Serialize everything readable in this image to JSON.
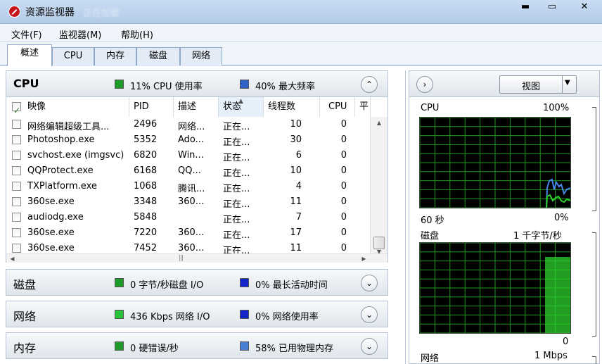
{
  "window": {
    "title": "资源监视器",
    "title_ghost": "正在加载",
    "min_glyph": "▬",
    "max_glyph": "▭",
    "close_glyph": "✕"
  },
  "menu": [
    "文件(F)",
    "监视器(M)",
    "帮助(H)"
  ],
  "tabs": [
    {
      "label": "概述",
      "active": true
    },
    {
      "label": "CPU",
      "active": false
    },
    {
      "label": "内存",
      "active": false
    },
    {
      "label": "磁盘",
      "active": false
    },
    {
      "label": "网络",
      "active": false
    }
  ],
  "cpu_section": {
    "title": "CPU",
    "legend1": "11% CPU 使用率",
    "legend1_color": "#1c9a2a",
    "legend2": "40% 最大频率",
    "legend2_color": "#2f62c9",
    "toggle_glyph": "⌃",
    "columns": [
      "映像",
      "PID",
      "描述",
      "状态",
      "线程数",
      "CPU",
      "平"
    ],
    "rows": [
      {
        "image": "网络编辑超级工具...",
        "pid": "2496",
        "desc": "网络...",
        "status": "正在...",
        "threads": "10",
        "cpu": "0"
      },
      {
        "image": "Photoshop.exe",
        "pid": "5352",
        "desc": "Ado...",
        "status": "正在...",
        "threads": "30",
        "cpu": "0"
      },
      {
        "image": "svchost.exe (imgsvc)",
        "pid": "6820",
        "desc": "Win...",
        "status": "正在...",
        "threads": "6",
        "cpu": "0"
      },
      {
        "image": "QQProtect.exe",
        "pid": "6168",
        "desc": "QQ...",
        "status": "正在...",
        "threads": "10",
        "cpu": "0"
      },
      {
        "image": "TXPlatform.exe",
        "pid": "1068",
        "desc": "腾讯...",
        "status": "正在...",
        "threads": "4",
        "cpu": "0"
      },
      {
        "image": "360se.exe",
        "pid": "3348",
        "desc": "360...",
        "status": "正在...",
        "threads": "11",
        "cpu": "0"
      },
      {
        "image": "audiodg.exe",
        "pid": "5848",
        "desc": "",
        "status": "正在...",
        "threads": "7",
        "cpu": "0"
      },
      {
        "image": "360se.exe",
        "pid": "7220",
        "desc": "360...",
        "status": "正在...",
        "threads": "17",
        "cpu": "0"
      },
      {
        "image": "360se.exe",
        "pid": "7452",
        "desc": "360...",
        "status": "正在...",
        "threads": "11",
        "cpu": "0"
      }
    ]
  },
  "disk_section": {
    "title": "磁盘",
    "legend1": "0 字节/秒磁盘 I/O",
    "legend1_color": "#1c9a2a",
    "legend2": "0% 最长活动时间",
    "legend2_color": "#1426c8",
    "toggle_glyph": "⌄"
  },
  "network_section": {
    "title": "网络",
    "legend1": "436 Kbps 网络 I/O",
    "legend1_color": "#27c43a",
    "legend2": "0% 网络使用率",
    "legend2_color": "#1426c8",
    "toggle_glyph": "⌄"
  },
  "memory_section": {
    "title": "内存",
    "legend1": "0 硬错误/秒",
    "legend1_color": "#1c9a2a",
    "legend2": "58% 已用物理内存",
    "legend2_color": "#4a7fd6",
    "toggle_glyph": "⌄"
  },
  "right": {
    "expand_glyph": "›",
    "view_label": "视图",
    "view_arrow": "▼",
    "cpu_graph": {
      "label": "CPU",
      "max": "100%",
      "time": "60 秒",
      "min": "0%"
    },
    "disk_graph": {
      "label": "磁盘",
      "max": "1 千字节/秒",
      "min": "0"
    },
    "net_graph": {
      "label": "网络",
      "max": "1 Mbps"
    },
    "grid_color": "#1e9a1e",
    "line_blue": "#4a86e8",
    "line_green": "#2cd12c"
  }
}
